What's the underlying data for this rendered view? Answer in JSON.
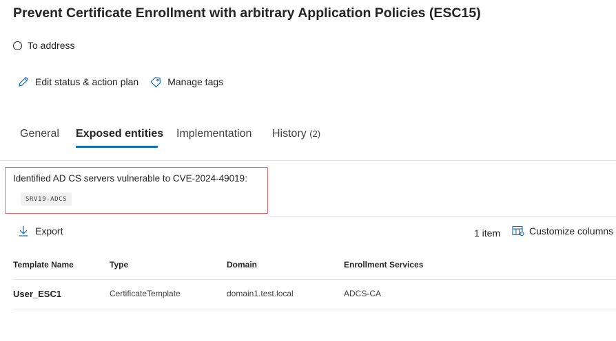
{
  "page": {
    "title": "Prevent Certificate Enrollment with arbitrary Application Policies (ESC15)",
    "status_label": "To address"
  },
  "actions": {
    "edit_status": "Edit status & action plan",
    "manage_tags": "Manage tags"
  },
  "tabs": [
    {
      "label": "General",
      "active": false
    },
    {
      "label": "Exposed entities",
      "active": true
    },
    {
      "label": "Implementation",
      "active": false
    },
    {
      "label": "History",
      "count": "(2)",
      "active": false
    }
  ],
  "vulnerable": {
    "text": "Identified AD CS servers vulnerable to CVE-2024-49019:",
    "server": "SRV19-ADCS"
  },
  "toolbar": {
    "export_label": "Export",
    "item_count": "1 item",
    "customize_label": "Customize columns"
  },
  "table": {
    "headers": [
      "Template Name",
      "Type",
      "Domain",
      "Enrollment Services"
    ],
    "rows": [
      [
        "User_ESC1",
        "CertificateTemplate",
        "domain1.test.local",
        "ADCS-CA"
      ]
    ]
  },
  "colors": {
    "accent": "#0f6cbd",
    "highlight_border": "#e8656b"
  },
  "icons": [
    "status-circle-icon",
    "pencil-icon",
    "tag-icon",
    "download-icon",
    "customize-columns-icon"
  ]
}
